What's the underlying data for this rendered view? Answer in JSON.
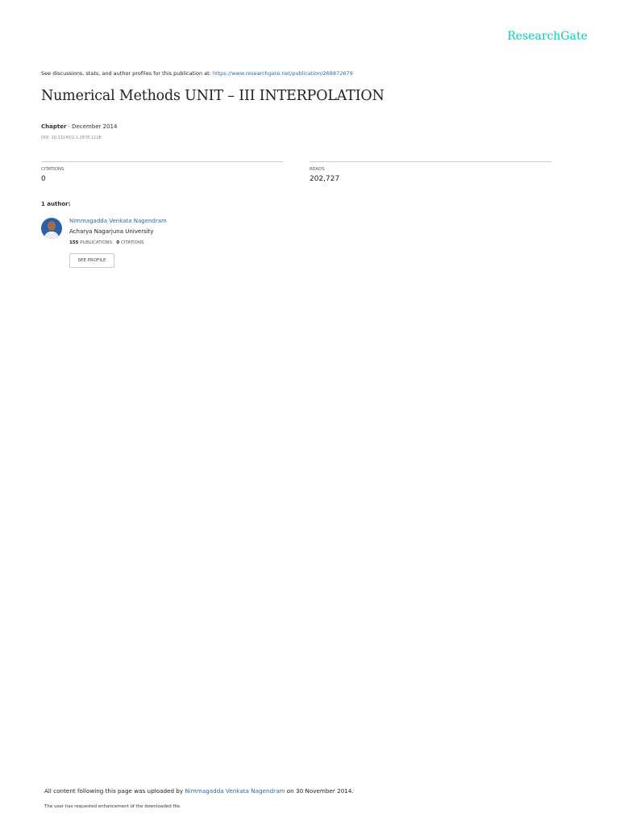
{
  "header": {
    "logo": "ResearchGate"
  },
  "discussion": {
    "text": "See discussions, stats, and author profiles for this publication at: ",
    "url": "https://www.researchgate.net/publication/268872679"
  },
  "publication": {
    "title": "Numerical Methods UNIT – III INTERPOLATION",
    "type": "Chapter",
    "date": " · December 2014",
    "doi": "DOI: 10.13140/2.1.2878.1128"
  },
  "stats": {
    "citations_label": "CITATIONS",
    "citations_value": "0",
    "reads_label": "READS",
    "reads_value": "202,727"
  },
  "authors": {
    "heading": "1 author:",
    "list": [
      {
        "name": "Nimmagadda Venkata Nagendram",
        "institution": "Acharya Nagarjuna University",
        "publications_count": "155",
        "publications_label": " PUBLICATIONS",
        "citations_count": "0",
        "citations_label": " CITATIONS",
        "button": "SEE PROFILE"
      }
    ]
  },
  "footer": {
    "upload_prefix": "All content following this page was uploaded by ",
    "uploader": "Nimmagadda Venkata Nagendram",
    "upload_suffix": " on 30 November 2014.",
    "request_note": "The user has requested enhancement of the downloaded file."
  }
}
